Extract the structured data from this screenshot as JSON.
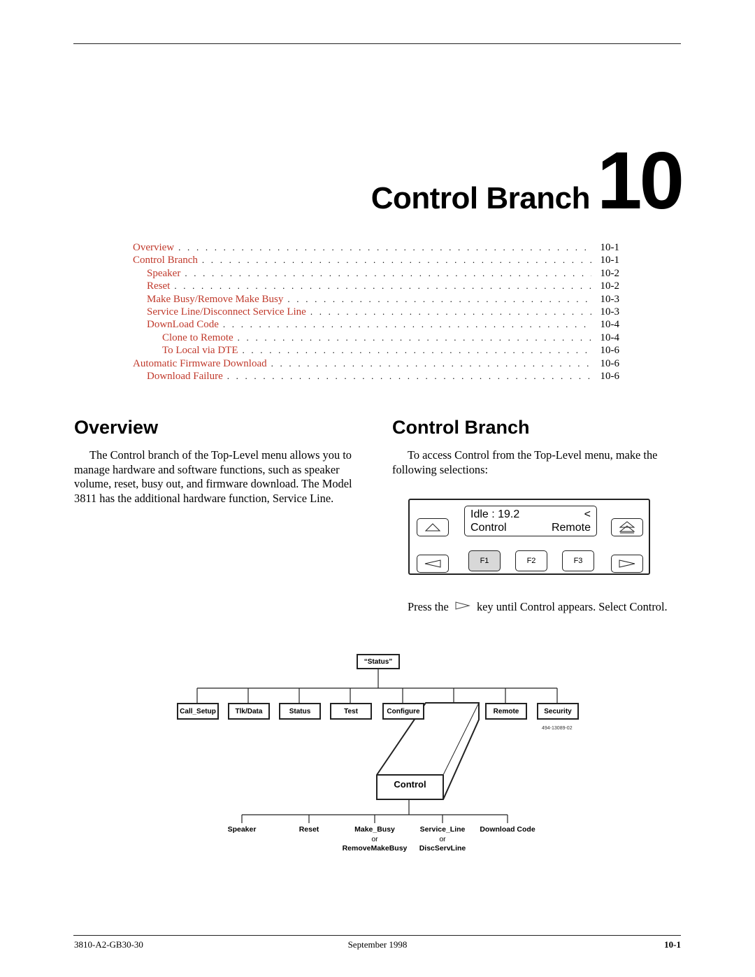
{
  "page": {
    "chapter_title": "Control Branch",
    "chapter_number": "10"
  },
  "toc": [
    {
      "label": "Overview",
      "page": "10-1",
      "level": 0
    },
    {
      "label": "Control Branch",
      "page": "10-1",
      "level": 0
    },
    {
      "label": "Speaker",
      "page": "10-2",
      "level": 1
    },
    {
      "label": "Reset",
      "page": "10-2",
      "level": 1
    },
    {
      "label": "Make Busy/Remove Make Busy",
      "page": "10-3",
      "level": 1
    },
    {
      "label": "Service Line/Disconnect Service Line",
      "page": "10-3",
      "level": 1
    },
    {
      "label": "DownLoad Code",
      "page": "10-4",
      "level": 1
    },
    {
      "label": "Clone to Remote",
      "page": "10-4",
      "level": 2
    },
    {
      "label": "To Local via DTE",
      "page": "10-6",
      "level": 2
    },
    {
      "label": "Automatic Firmware Download",
      "page": "10-6",
      "level": 0
    },
    {
      "label": "Download Failure",
      "page": "10-6",
      "level": 1
    }
  ],
  "overview": {
    "heading": "Overview",
    "paragraph": "The Control branch of the Top-Level menu allows you to manage hardware and software functions, such as speaker volume, reset, busy out, and firmware download. The Model 3811 has the additional hardware function, Service Line."
  },
  "control_branch": {
    "heading": "Control Branch",
    "paragraph": "To access Control from the Top-Level menu, make the following selections:",
    "press_before": "Press the",
    "press_after": "key until Control appears. Select Control."
  },
  "front_panel": {
    "lcd_line1_left": "Idle : 19.2",
    "lcd_line1_right": "<",
    "lcd_line2_left": "Control",
    "lcd_line2_right": "Remote",
    "f1": "F1",
    "f2": "F2",
    "f3": "F3",
    "selected_key": "F1",
    "colors": {
      "selected_key_fill": "#d8d8d8"
    }
  },
  "diagram": {
    "root": "“Status”",
    "top_level": [
      "Call_Setup",
      "Tlk/Data",
      "Status",
      "Test",
      "Configure",
      "Control",
      "Remote",
      "Security"
    ],
    "expanded": "Control",
    "figure_id": "494-13089-02",
    "children": [
      {
        "label": "Speaker"
      },
      {
        "label": "Reset"
      },
      {
        "label": "Make_Busy",
        "or": "or",
        "alt": "RemoveMakeBusy"
      },
      {
        "label": "Service_Line",
        "or": "or",
        "alt": "DiscServLine"
      },
      {
        "label": "Download Code"
      }
    ]
  },
  "footer": {
    "doc_number": "3810-A2-GB30-30",
    "date": "September 1998",
    "page_number": "10-1"
  },
  "colors": {
    "toc_link": "#c0392b",
    "text": "#000000"
  }
}
